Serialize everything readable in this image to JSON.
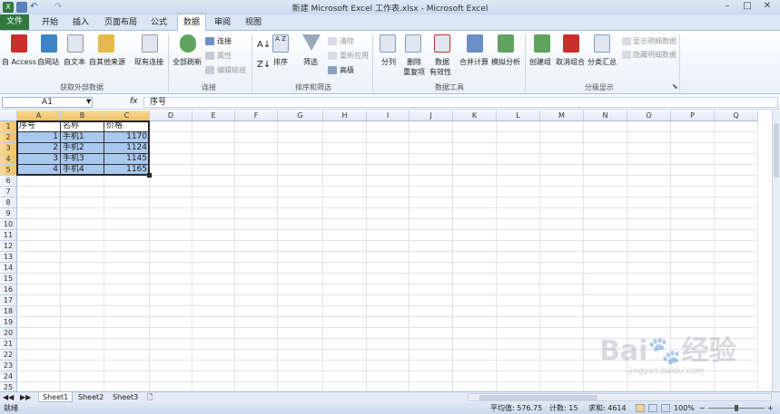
{
  "window": {
    "title": "新建 Microsoft Excel 工作表.xlsx - Microsoft Excel"
  },
  "tabs": [
    "开始",
    "插入",
    "页面布局",
    "公式",
    "数据",
    "审阅",
    "视图"
  ],
  "file_tab": "文件",
  "active_tab": "数据",
  "ribbon": {
    "external": {
      "btn_access": "自 Access",
      "btn_web": "自网站",
      "btn_text": "自文本",
      "btn_other": "自其他来源",
      "btn_existing": "现有连接",
      "label": "获取外部数据"
    },
    "connections": {
      "refresh_all": "全部刷新",
      "connections": "连接",
      "properties": "属性",
      "edit_links": "编辑链接",
      "label": "连接"
    },
    "sortfilter": {
      "sort": "排序",
      "filter": "筛选",
      "clear": "清除",
      "reapply": "重新应用",
      "advanced": "高级",
      "label": "排序和筛选"
    },
    "datatools": {
      "text_to_cols": "分列",
      "remove_dup_1": "删除",
      "remove_dup_2": "重复项",
      "validation_1": "数据",
      "validation_2": "有效性",
      "consolidate": "合并计算",
      "whatif": "模拟分析",
      "label": "数据工具"
    },
    "outline": {
      "group": "创建组",
      "ungroup": "取消组合",
      "subtotal": "分类汇总",
      "show_detail": "显示明细数据",
      "hide_detail": "隐藏明细数据",
      "label": "分级显示"
    }
  },
  "formula_bar": {
    "name_box": "A1",
    "fx": "fx",
    "value": "序号"
  },
  "columns": [
    "A",
    "B",
    "C",
    "D",
    "E",
    "F",
    "G",
    "H",
    "I",
    "J",
    "K",
    "L",
    "M",
    "N",
    "O",
    "P",
    "Q"
  ],
  "rows": [
    "1",
    "2",
    "3",
    "4",
    "5",
    "6",
    "7",
    "8",
    "9",
    "10",
    "11",
    "12",
    "13",
    "14",
    "15",
    "16",
    "17",
    "18",
    "19",
    "20",
    "21",
    "22",
    "23",
    "24",
    "25"
  ],
  "table": {
    "header": [
      "序号",
      "名称",
      "价格"
    ],
    "rows": [
      [
        "1",
        "手机1",
        "1170"
      ],
      [
        "2",
        "手机2",
        "1124"
      ],
      [
        "3",
        "手机3",
        "1145"
      ],
      [
        "4",
        "手机4",
        "1165"
      ]
    ]
  },
  "sheets": [
    "Sheet1",
    "Sheet2",
    "Sheet3"
  ],
  "status": {
    "ready": "就绪",
    "average": "平均值: 576.75",
    "count": "计数: 15",
    "sum": "求和: 4614",
    "zoom": "100%"
  },
  "watermark": {
    "main": "Bai🐾经验",
    "sub": "jingyan.baidu.com"
  },
  "colors": {
    "file_tab": "#2f7a3b",
    "selection": "#a9c8ee",
    "header_selected": "#f1c15f"
  }
}
